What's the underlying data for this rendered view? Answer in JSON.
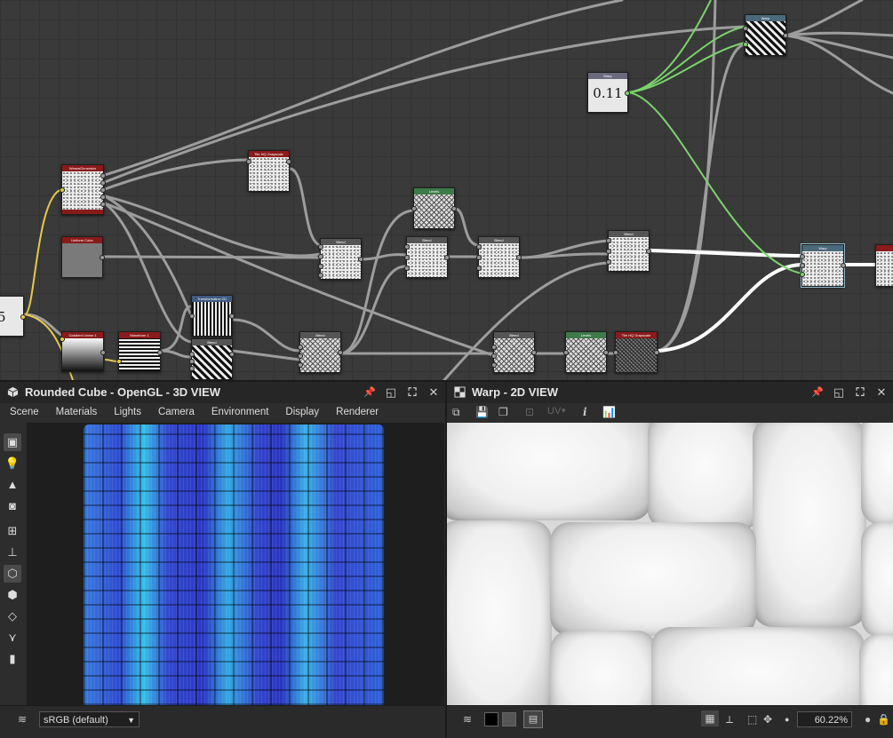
{
  "graph": {
    "nodes": [
      {
        "id": "weave",
        "title": "WeaveGenerator",
        "type": "noise",
        "hdr": "#8b1a1a"
      },
      {
        "id": "uniform",
        "title": "Uniform Color",
        "type": "gray",
        "hdr": "#8b1a1a"
      },
      {
        "id": "gradient",
        "title": "Gradient Linear 1",
        "type": "gradient",
        "hdr": "#8b1a1a"
      },
      {
        "id": "waveform",
        "title": "Waveform 1",
        "type": "stripes-h",
        "hdr": "#8b1a1a"
      },
      {
        "id": "transformation",
        "title": "Transformation 2D",
        "type": "stripes-v",
        "hdr": "#3d5a80"
      },
      {
        "id": "blend-check",
        "title": "Blend",
        "type": "checker",
        "hdr": "#555"
      },
      {
        "id": "tile-grayscale",
        "title": "Tile HQ Grayscale",
        "type": "noise",
        "hdr": "#8b1a1a"
      },
      {
        "id": "blend1",
        "title": "Blend",
        "type": "noise",
        "hdr": "#555"
      },
      {
        "id": "levels",
        "title": "Levels",
        "type": "weave",
        "hdr": "#3e7a4a"
      },
      {
        "id": "blend2",
        "title": "Blend",
        "type": "noise",
        "hdr": "#555"
      },
      {
        "id": "blend3",
        "title": "Blend",
        "type": "noise",
        "hdr": "#555"
      },
      {
        "id": "blend4",
        "title": "Blend",
        "type": "noise",
        "hdr": "#555"
      },
      {
        "id": "blend5",
        "title": "Blend",
        "type": "weave",
        "hdr": "#555"
      },
      {
        "id": "blend6",
        "title": "Blend",
        "type": "weave",
        "hdr": "#555"
      },
      {
        "id": "levels2",
        "title": "Levels",
        "type": "weave",
        "hdr": "#3e7a4a"
      },
      {
        "id": "tile-grayscale2",
        "title": "Tile HQ Grayscale",
        "type": "weave-dark",
        "hdr": "#8b1a1a"
      },
      {
        "id": "warp-value",
        "title": "Warp",
        "value": "0.11",
        "hdr": "#6a6a7a"
      },
      {
        "id": "warp-top",
        "title": "Warp",
        "type": "checker",
        "hdr": "#4a6a7a"
      },
      {
        "id": "warp",
        "title": "Warp",
        "type": "noise",
        "hdr": "#4a6a7a"
      },
      {
        "id": "edge-value",
        "value": "5"
      }
    ]
  },
  "panel3d": {
    "title": "Rounded Cube - OpenGL - 3D VIEW",
    "menu": [
      "Scene",
      "Materials",
      "Lights",
      "Camera",
      "Environment",
      "Display",
      "Renderer"
    ],
    "colorspace": "sRGB (default)",
    "icons": [
      "camera-icon",
      "light-bulb-icon",
      "environment-icon",
      "screenshot-icon",
      "scene-icon",
      "axis-icon",
      "cube-icon",
      "wire-cube-icon",
      "layers-icon",
      "tangent-icon",
      "histogram-icon"
    ]
  },
  "panel2d": {
    "title": "Warp - 2D VIEW",
    "uv_label": "UV",
    "info_label": "i",
    "zoom": "60.22%"
  },
  "panel_buttons": {
    "pin": "📌",
    "float": "◱",
    "max": "⛶",
    "close": "✕"
  }
}
